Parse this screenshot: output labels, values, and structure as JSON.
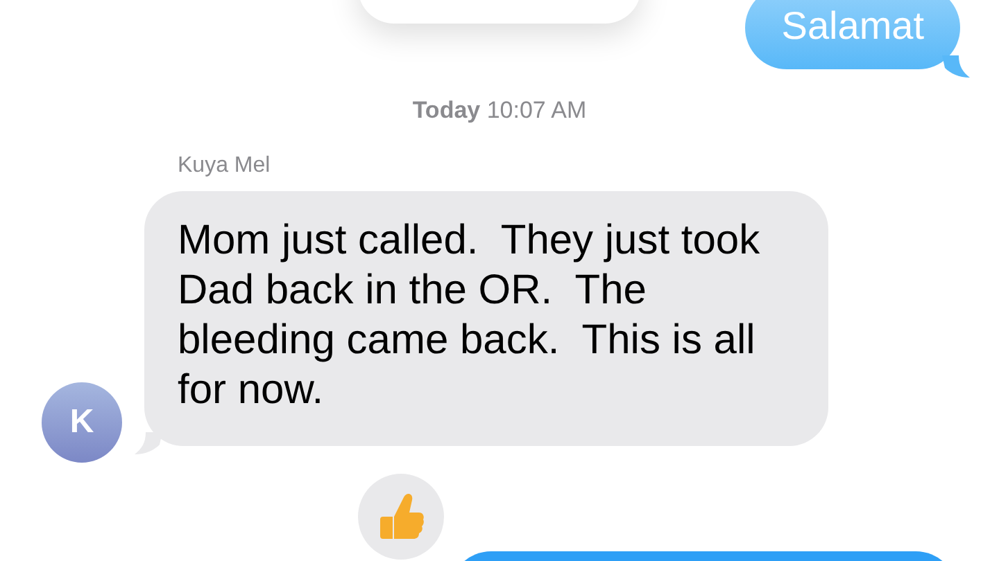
{
  "thread": [
    {
      "kind": "card"
    },
    {
      "kind": "sent",
      "text": "Salamat"
    },
    {
      "kind": "timestamp",
      "day": "Today",
      "time": "10:07 AM"
    },
    {
      "kind": "received",
      "sender": "Kuya Mel",
      "avatar": "K",
      "text": "Mom just called.  They just took Dad back in the OR.  The bleeding came back.  This is all for now."
    },
    {
      "kind": "sent",
      "liked": true
    }
  ]
}
